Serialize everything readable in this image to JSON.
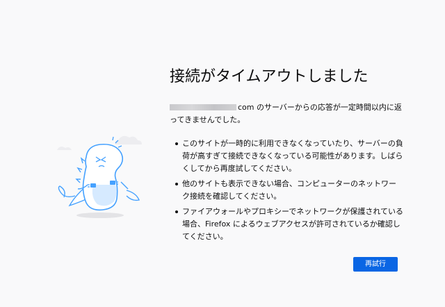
{
  "error": {
    "title": "接続がタイムアウトしました",
    "description_suffix": "com のサーバーからの応答が一定時間以内に返ってきませんでした。",
    "reasons": [
      "このサイトが一時的に利用できなくなっていたり、サーバーの負荷が高すぎて接続できなくなっている可能性があります。しばらくしてから再度試してください。",
      "他のサイトも表示できない場合、コンピューターのネットワーク接続を確認してください。",
      "ファイアウォールやプロキシーでネットワークが保護されている場合、Firefox によるウェブアクセスが許可されているか確認してください。"
    ],
    "retry_label": "再試行"
  },
  "icons": {
    "illustration": "dinosaur-unplugged-illustration"
  },
  "colors": {
    "accent": "#0a66e4",
    "background": "#f9f9fa",
    "illustration_stroke": "#45a1ff"
  }
}
